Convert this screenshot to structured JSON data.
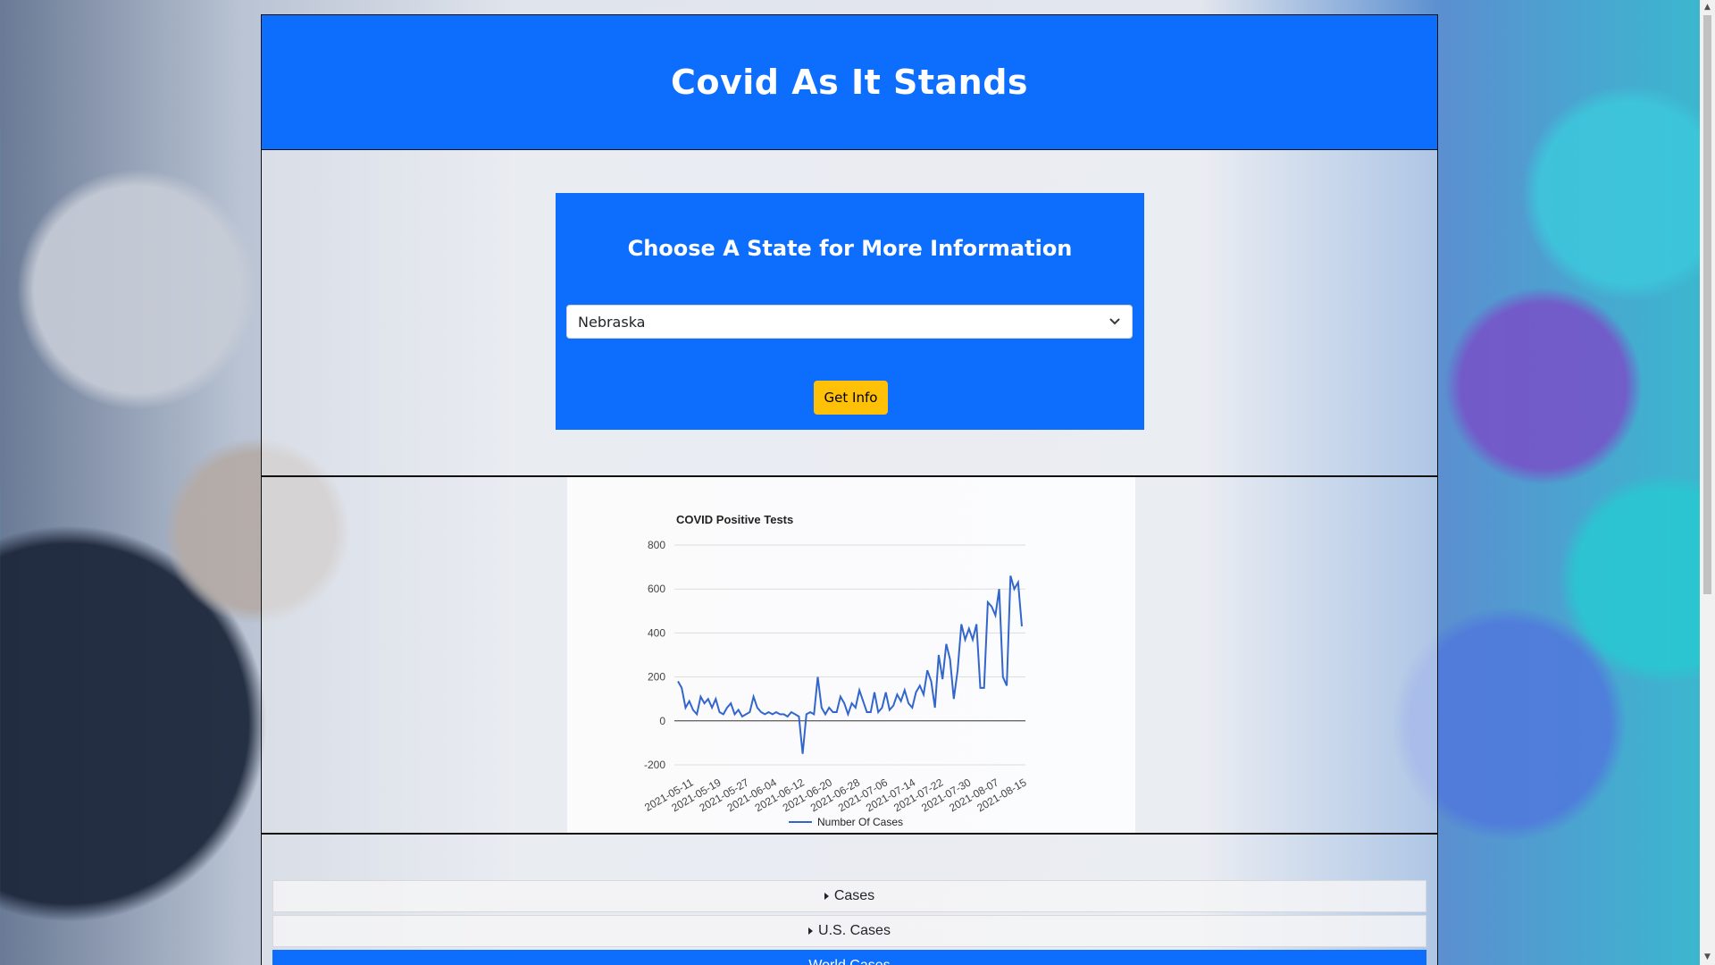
{
  "header": {
    "title": "Covid As It Stands"
  },
  "state_picker": {
    "heading": "Choose A State for More Information",
    "selected_state": "Nebraska",
    "button_label": "Get Info"
  },
  "chart_data": {
    "type": "line",
    "title": "COVID Positive Tests",
    "xlabel": "",
    "ylabel": "",
    "ylim": [
      -200,
      800
    ],
    "yticks": [
      -200,
      0,
      200,
      400,
      600,
      800
    ],
    "grid": true,
    "legend_position": "bottom",
    "tick_labels": [
      "2021-05-11",
      "2021-05-19",
      "2021-05-27",
      "2021-06-04",
      "2021-06-12",
      "2021-06-20",
      "2021-06-28",
      "2021-07-06",
      "2021-07-14",
      "2021-07-22",
      "2021-07-30",
      "2021-08-07",
      "2021-08-15"
    ],
    "series": [
      {
        "name": "Number Of Cases",
        "color": "#3366cc",
        "values": [
          180,
          150,
          60,
          90,
          50,
          30,
          110,
          80,
          100,
          60,
          100,
          40,
          30,
          60,
          80,
          30,
          50,
          20,
          30,
          40,
          110,
          60,
          40,
          30,
          40,
          30,
          40,
          30,
          30,
          20,
          40,
          30,
          20,
          -150,
          30,
          40,
          30,
          200,
          60,
          30,
          60,
          40,
          40,
          110,
          80,
          30,
          80,
          60,
          140,
          90,
          40,
          40,
          130,
          40,
          60,
          130,
          50,
          70,
          120,
          90,
          140,
          80,
          60,
          130,
          160,
          120,
          230,
          180,
          60,
          300,
          190,
          350,
          280,
          100,
          230,
          440,
          370,
          420,
          370,
          440,
          150,
          150,
          540,
          520,
          480,
          600,
          200,
          160,
          660,
          600,
          630,
          430
        ]
      }
    ]
  },
  "accordion": {
    "items": [
      {
        "label": "Cases"
      },
      {
        "label": "U.S. Cases"
      },
      {
        "label": "World Cases"
      }
    ]
  }
}
